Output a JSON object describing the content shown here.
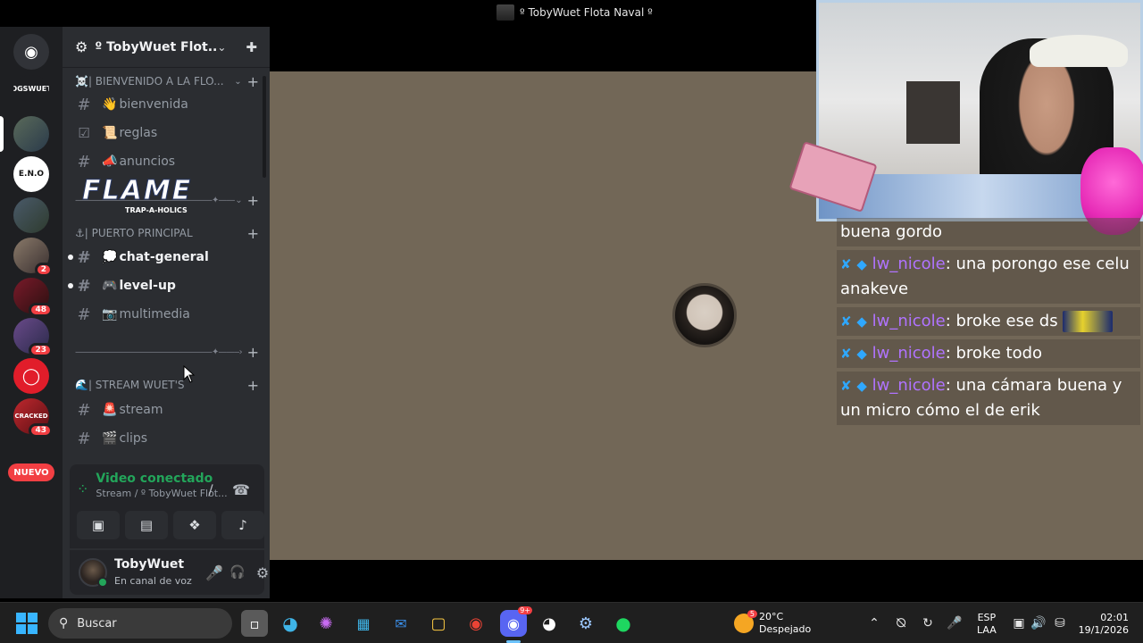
{
  "window": {
    "title": "º TobyWuet Flota Naval º"
  },
  "rail": {
    "badges": [
      "2",
      "48",
      "23",
      "43"
    ],
    "nuevo_label": "NUEVO",
    "server_labels": [
      "OGSWUET",
      "E.N.O",
      "CRACKED"
    ]
  },
  "server": {
    "name": "º TobyWuet Flot..."
  },
  "categories": [
    {
      "label": "☠️| BIENVENIDO A LA FLO..."
    },
    {
      "label": "—————————————————✦——————..."
    },
    {
      "label": "⚓| PUERTO PRINCIPAL"
    },
    {
      "label": "—————————————————✦——————..."
    },
    {
      "label": "🌊| STREAM WUET'S"
    }
  ],
  "channels": [
    {
      "emoji": "👋",
      "name": "bienvenida",
      "icon": "#"
    },
    {
      "emoji": "📜",
      "name": "reglas",
      "icon": "☑"
    },
    {
      "emoji": "📣",
      "name": "anuncios",
      "icon": "#"
    },
    {
      "emoji": "💭",
      "name": "chat-general",
      "icon": "#"
    },
    {
      "emoji": "🎮",
      "name": "level-up",
      "icon": "#"
    },
    {
      "emoji": "📷",
      "name": "multimedia",
      "icon": "#"
    },
    {
      "emoji": "🚨",
      "name": "stream",
      "icon": "#"
    },
    {
      "emoji": "🎬",
      "name": "clips",
      "icon": "#"
    }
  ],
  "voice": {
    "status": "Video conectado",
    "channel": "Stream / º TobyWuet Flot..."
  },
  "user": {
    "name": "TobyWuet",
    "status": "En canal de voz"
  },
  "overlay": {
    "banner": "FLAME",
    "banner_sub": "TRAP-A-HOLICS"
  },
  "chat": [
    {
      "user": "",
      "text": "buena gordo"
    },
    {
      "user": "lw_nicole",
      "text": ": una porongo ese celu anakeve"
    },
    {
      "user": "lw_nicole",
      "text": ": broke ese ds",
      "emote": true
    },
    {
      "user": "lw_nicole",
      "text": ": broke todo"
    },
    {
      "user": "lw_nicole",
      "text": ": una cámara buena y un micro cómo el de erik"
    }
  ],
  "taskbar": {
    "search_placeholder": "Buscar",
    "weather_temp": "20°C",
    "weather_desc": "Despejado",
    "weather_badge": "5",
    "lang_1": "ESP",
    "lang_2": "LAA",
    "time": "02:01",
    "date": "19/1/2026",
    "discord_badge": "9+"
  },
  "colors": {
    "accent_green": "#23a55a",
    "mention_red": "#f23f43",
    "chat_user": "#b073ff"
  }
}
